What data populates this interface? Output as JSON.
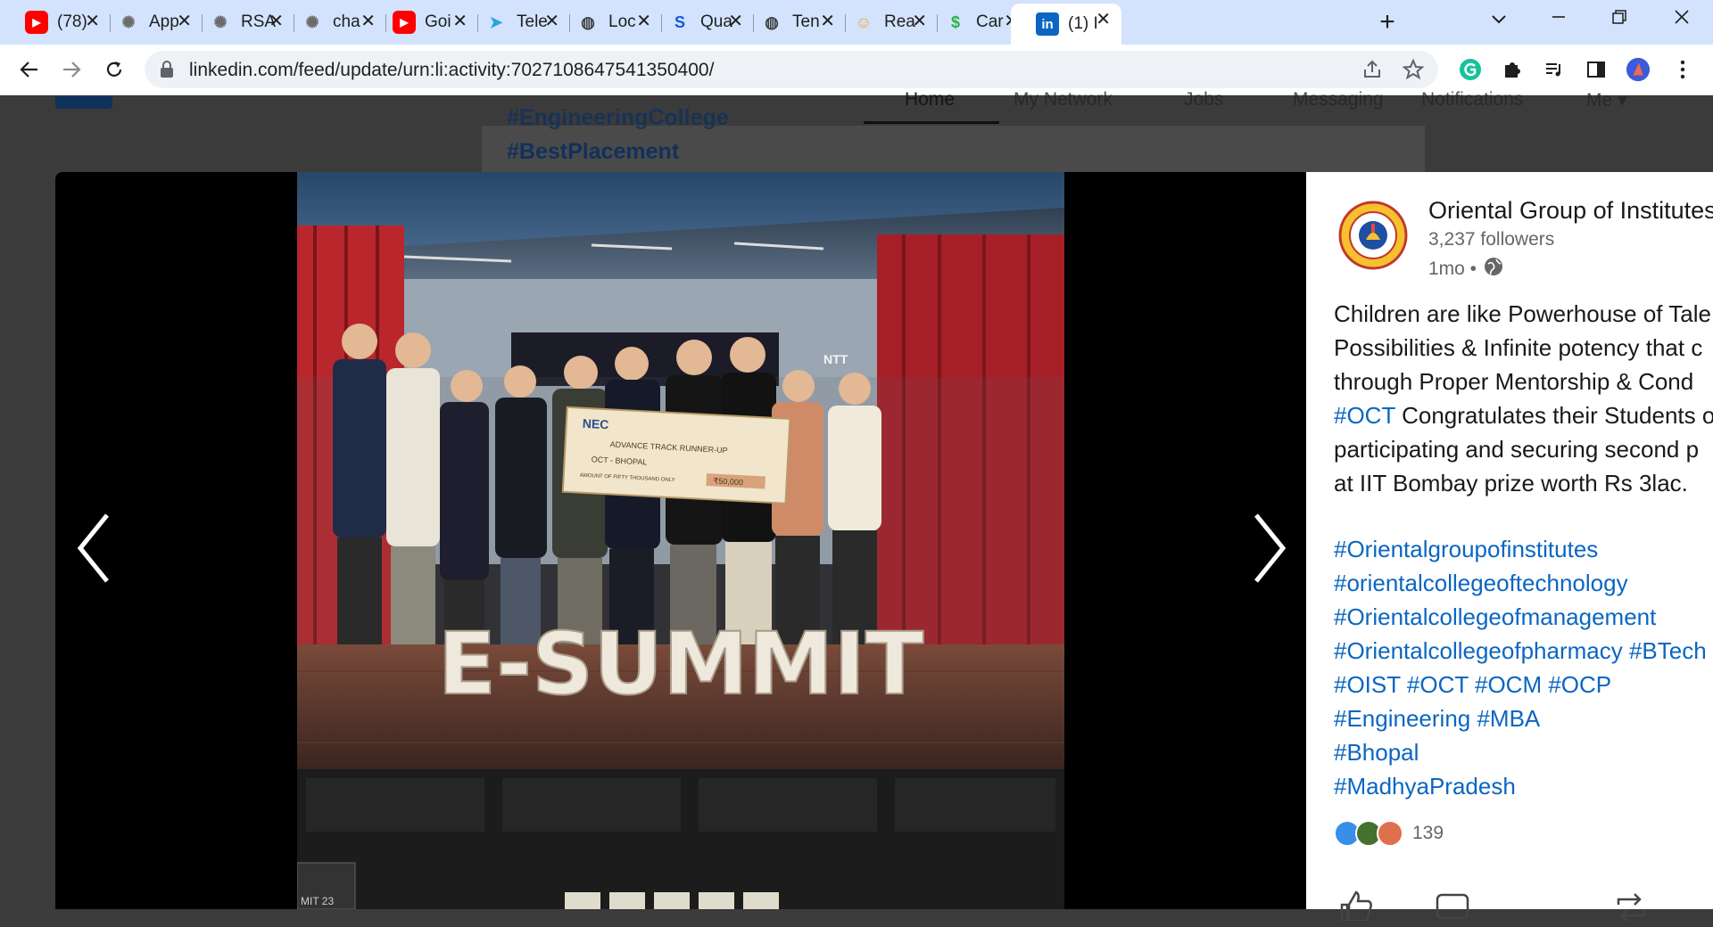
{
  "browser": {
    "tabs": [
      {
        "label": "(78)",
        "icon": "youtube-icon",
        "color": "#ff0000"
      },
      {
        "label": "App",
        "icon": "chatgpt-icon",
        "color": "#6b6b6b"
      },
      {
        "label": "RSA",
        "icon": "chatgpt-icon",
        "color": "#6b6b6b"
      },
      {
        "label": "cha",
        "icon": "chatgpt-icon",
        "color": "#6b6b6b"
      },
      {
        "label": "Goi",
        "icon": "youtube-icon",
        "color": "#ff0000"
      },
      {
        "label": "Tele",
        "icon": "telegram-icon",
        "color": "#2aa4e2"
      },
      {
        "label": "Loc",
        "icon": "globe-icon",
        "color": "#444444"
      },
      {
        "label": "Qua",
        "icon": "s-logo-icon",
        "color": "#1a56db"
      },
      {
        "label": "Ten",
        "icon": "globe-icon",
        "color": "#444444"
      },
      {
        "label": "Rea",
        "icon": "emoji-icon",
        "color": "#f5a623"
      },
      {
        "label": "Car",
        "icon": "dollar-icon",
        "color": "#2cb34a"
      },
      {
        "label": "(1) I",
        "icon": "linkedin-icon",
        "color": "#0a66c2"
      }
    ],
    "new_tab": "+",
    "url": "linkedin.com/feed/update/urn:li:activity:7027108647541350400/"
  },
  "linkedin_nav": {
    "items": [
      "Home",
      "My Network",
      "Jobs",
      "Messaging",
      "Notifications",
      "Me"
    ]
  },
  "background_feed": {
    "partial_hashtag": "#EngineeringCollege",
    "hashtag": "#BestPlacement"
  },
  "photo": {
    "banner": "E-SUMMIT",
    "cheque_org": "NEC",
    "cheque_title": "ADVANCE TRACK RUNNER-UP",
    "cheque_payee": "OCT - BHOPAL",
    "cheque_amount": "₹50,000",
    "cheque_words": "AMOUNT OF FIFTY THOUSAND ONLY",
    "screen_text": "NTT",
    "podium_text": "MIT 23"
  },
  "post": {
    "org_name": "Oriental Group of Institutes",
    "followers": "3,237 followers",
    "time": "1mo •",
    "lines": [
      "Children are like Powerhouse of Tale",
      "Possibilities & Infinite potency that c",
      "through Proper Mentorship & Cond"
    ],
    "line4_hashtag": "#OCT",
    "line4_rest": " Congratulates their Students o",
    "line5": "participating and securing second p",
    "line6": "at IIT Bombay prize worth Rs 3lac.",
    "hashtag_lines": [
      "#Orientalgroupofinstitutes",
      "#orientalcollegeoftechnology",
      "#Orientalcollegeofmanagement",
      "#Orientalcollegeofpharmacy #BTech",
      "#OIST #OCT #OCM #OCP",
      "#Engineering #MBA",
      "#Bhopal",
      "#MadhyaPradesh"
    ],
    "reaction_count": "139",
    "brand_color": "#0a66c2"
  }
}
